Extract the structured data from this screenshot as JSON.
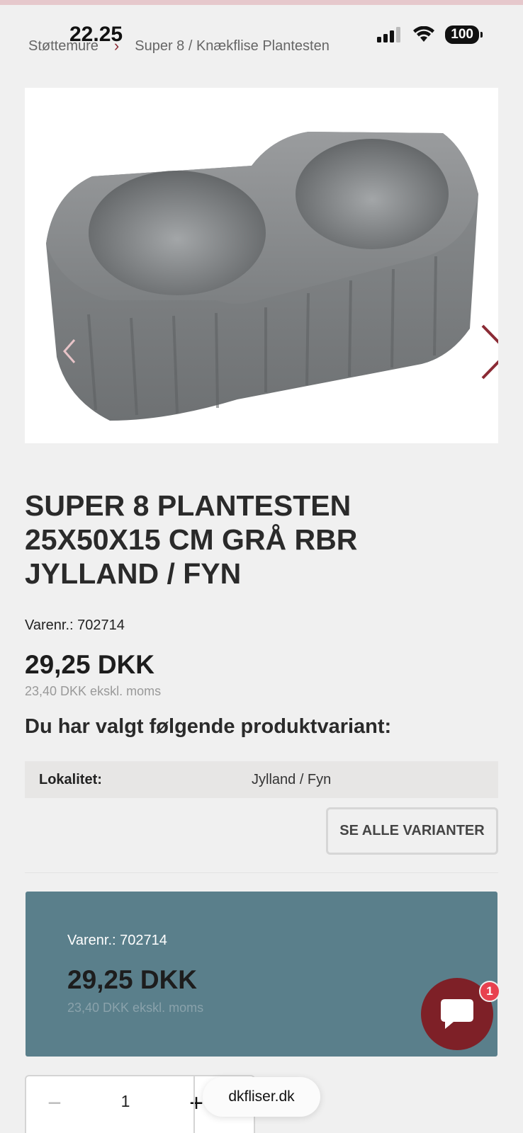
{
  "status_bar": {
    "time": "22.25",
    "battery": "100"
  },
  "breadcrumb": {
    "parent": "Støttemure",
    "current": "Super 8 / Knækflise Plantesten"
  },
  "product": {
    "title": "SUPER 8 PLANTESTEN 25X50X15 CM GRÅ RBR JYLLAND / FYN",
    "sku": "Varenr.: 702714",
    "price": "29,25 DKK",
    "price_ex_vat": "23,40 DKK ekskl. moms"
  },
  "variant": {
    "heading": "Du har valgt følgende produktvariant:",
    "key": "Lokalitet:",
    "value": "Jylland / Fyn",
    "see_all_label": "SE ALLE VARIANTER"
  },
  "buy_card": {
    "sku": "Varenr.: 702714",
    "price": "29,25 DKK",
    "price_ex_vat": "23,40 DKK ekskl. moms"
  },
  "quantity": {
    "value": "1",
    "minus": "−",
    "plus": "+"
  },
  "chat": {
    "badge": "1"
  },
  "browser": {
    "url": "dkfliser.dk"
  },
  "colors": {
    "accent": "#8b2b35",
    "card": "#5a7f8b",
    "chat": "#7e2027",
    "badge": "#e8414f"
  }
}
